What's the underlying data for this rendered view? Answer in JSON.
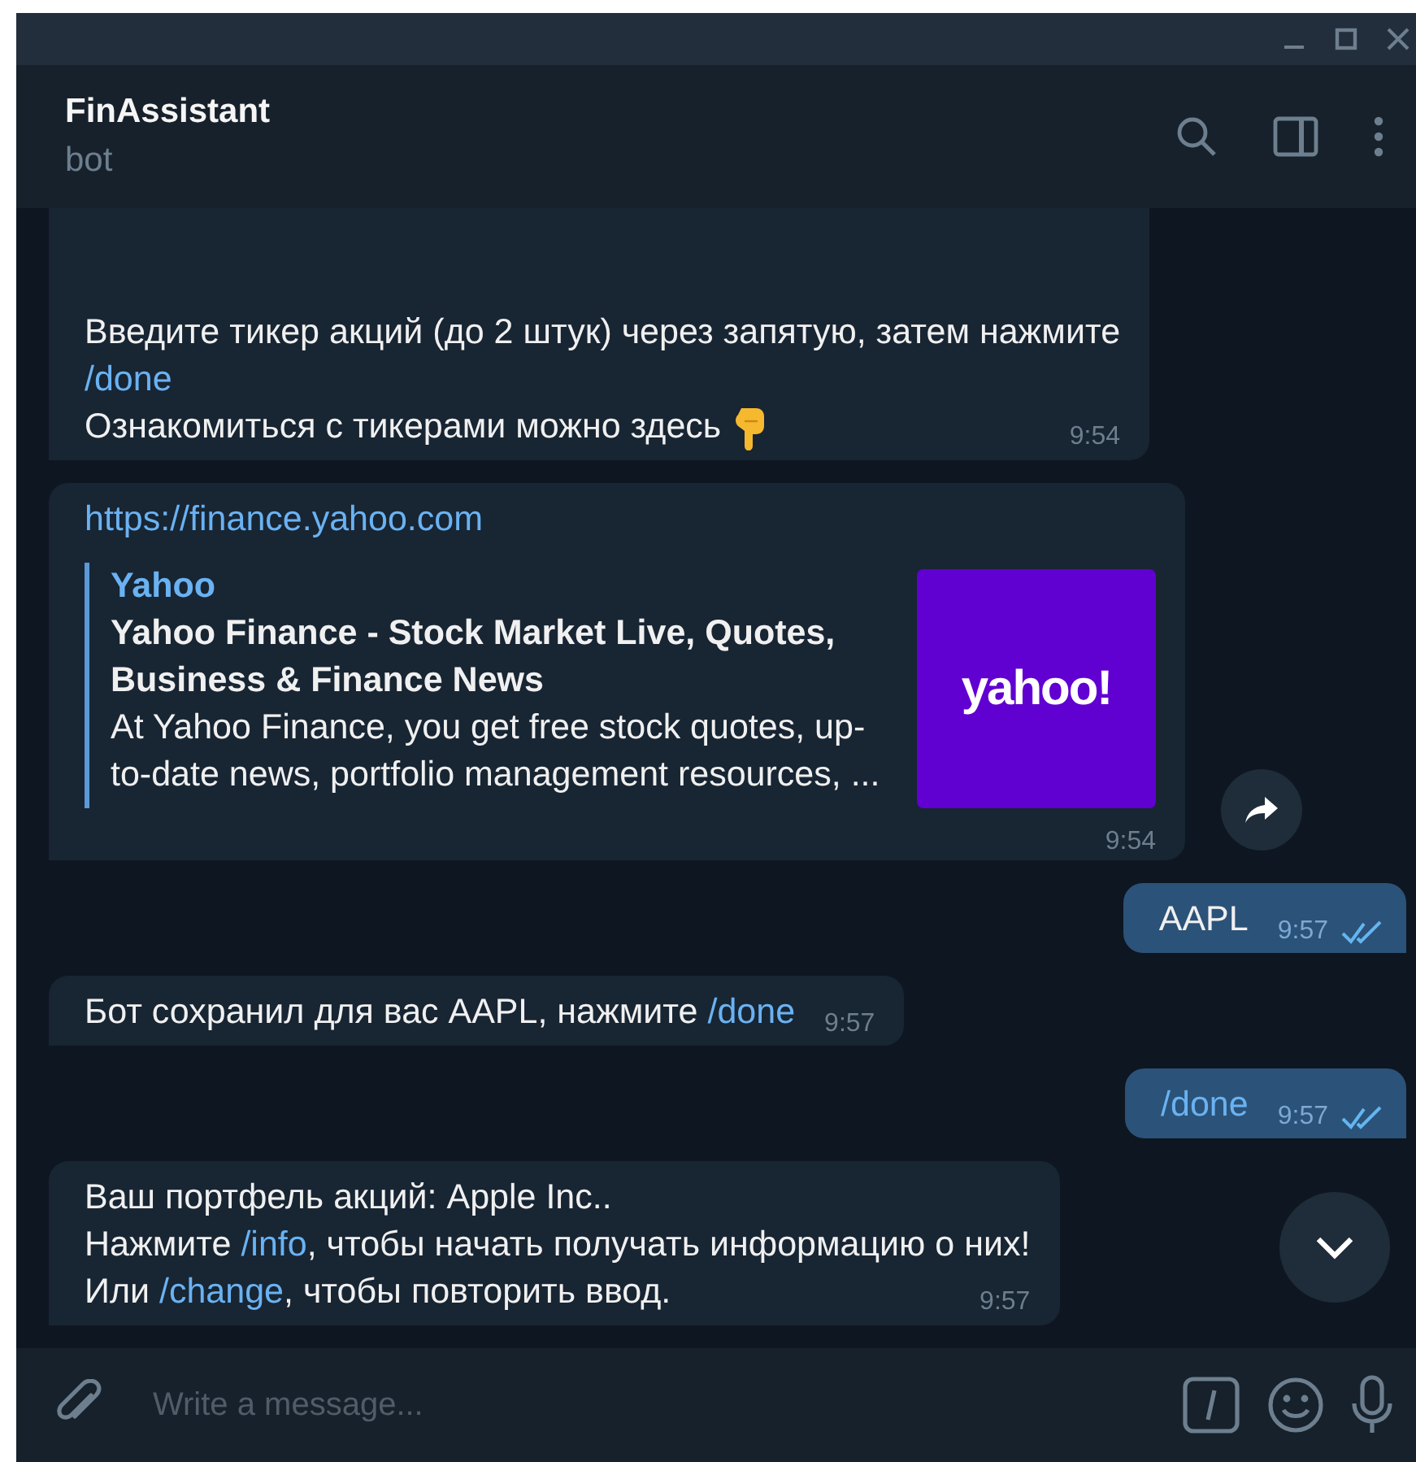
{
  "header": {
    "title": "FinAssistant",
    "subtitle": "bot"
  },
  "messages": [
    {
      "kind": "text",
      "outgoing": false,
      "lines": [
        [
          {
            "kind": "text",
            "text": "Введите тикер акций (до 2  штук) через запятую, затем нажмите"
          }
        ],
        [
          {
            "kind": "command",
            "text": "/done"
          }
        ],
        [
          {
            "kind": "text",
            "text": "Ознакомиться с тикерами можно здесь "
          },
          {
            "kind": "emoji"
          }
        ]
      ],
      "time": "9:54"
    },
    {
      "kind": "preview",
      "outgoing": false,
      "url": "https://finance.yahoo.com",
      "site": "Yahoo",
      "title": "Yahoo Finance - Stock Market Live, Quotes, Business & Finance News",
      "description": "At Yahoo Finance, you get free stock quotes, up-to-date news, portfolio management resources, ...",
      "logo": "yahoo!",
      "time": "9:54",
      "forward": true
    },
    {
      "kind": "text",
      "outgoing": true,
      "lines": [
        [
          {
            "kind": "text",
            "text": "AAPL"
          }
        ]
      ],
      "time": "9:57",
      "read": true
    },
    {
      "kind": "text",
      "outgoing": false,
      "lines": [
        [
          {
            "kind": "text",
            "text": "Бот сохранил для вас AAPL, нажмите "
          },
          {
            "kind": "command",
            "text": "/done"
          }
        ]
      ],
      "time": "9:57"
    },
    {
      "kind": "text",
      "outgoing": true,
      "lines": [
        [
          {
            "kind": "command",
            "text": "/done"
          }
        ]
      ],
      "time": "9:57",
      "read": true
    },
    {
      "kind": "text",
      "outgoing": false,
      "lines": [
        [
          {
            "kind": "text",
            "text": "Ваш портфель акций: Apple Inc.."
          }
        ],
        [
          {
            "kind": "text",
            "text": "Нажмите "
          },
          {
            "kind": "command",
            "text": "/info"
          },
          {
            "kind": "text",
            "text": ", чтобы начать получать информацию о них!"
          }
        ],
        [
          {
            "kind": "text",
            "text": "Или "
          },
          {
            "kind": "command",
            "text": "/change"
          },
          {
            "kind": "text",
            "text": ", чтобы повторить ввод."
          }
        ]
      ],
      "time": "9:57"
    }
  ],
  "scroll_down": true,
  "composer": {
    "placeholder": "Write a message..."
  }
}
